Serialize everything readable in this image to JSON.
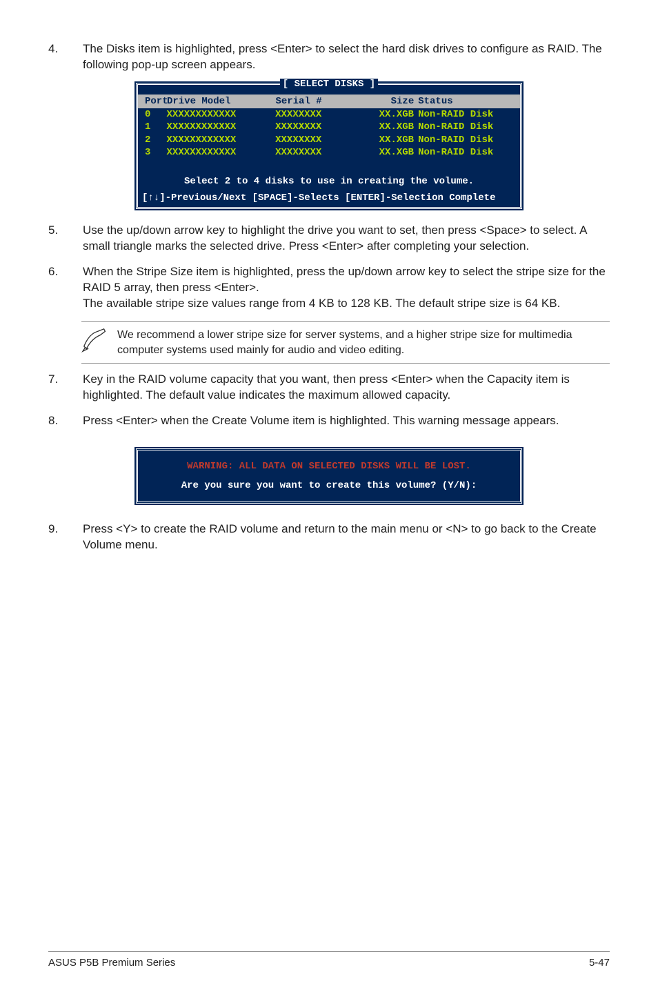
{
  "steps": {
    "s4": {
      "num": "4.",
      "text": "The Disks item is highlighted, press <Enter> to select the hard disk drives to configure as RAID. The following pop-up screen appears."
    },
    "s5": {
      "num": "5.",
      "text": "Use the up/down arrow key to highlight the drive you want to set, then press <Space> to select.  A small triangle marks the selected drive. Press <Enter> after completing your selection."
    },
    "s6": {
      "num": "6.",
      "text": "When the Stripe Size item is highlighted, press the up/down arrow key to select the stripe size for the RAID 5 array, then press <Enter>.\nThe available stripe size values range from 4 KB to 128 KB. The default stripe size is 64 KB."
    },
    "s7": {
      "num": "7.",
      "text": "Key in the RAID volume capacity that you want, then press <Enter> when the Capacity item is highlighted. The default value indicates the maximum allowed capacity."
    },
    "s8": {
      "num": "8.",
      "text": "Press <Enter> when the Create Volume item is highlighted. This warning message appears."
    },
    "s9": {
      "num": "9.",
      "text": "Press <Y> to create the RAID volume and return to the main menu or <N> to go back to the Create Volume menu."
    }
  },
  "note": {
    "text": "We recommend a lower stripe size for server systems, and a higher stripe size for multimedia computer systems used mainly for audio and video editing."
  },
  "console1": {
    "title": "[ SELECT DISKS ]",
    "header": {
      "port": "Port",
      "model": "Drive Model",
      "serial": "Serial #",
      "size": "Size",
      "status": "Status"
    },
    "rows": [
      {
        "port": "0",
        "model": "XXXXXXXXXXXX",
        "serial": "XXXXXXXX",
        "size": "XX.XGB",
        "status": "Non-RAID Disk"
      },
      {
        "port": "1",
        "model": "XXXXXXXXXXXX",
        "serial": "XXXXXXXX",
        "size": "XX.XGB",
        "status": "Non-RAID Disk"
      },
      {
        "port": "2",
        "model": "XXXXXXXXXXXX",
        "serial": "XXXXXXXX",
        "size": "XX.XGB",
        "status": "Non-RAID Disk"
      },
      {
        "port": "3",
        "model": "XXXXXXXXXXXX",
        "serial": "XXXXXXXX",
        "size": "XX.XGB",
        "status": "Non-RAID Disk"
      }
    ],
    "instruct": "Select 2 to 4 disks to use in creating the volume.",
    "footer": "[↑↓]-Previous/Next  [SPACE]-Selects  [ENTER]-Selection Complete"
  },
  "console2": {
    "warn": "WARNING: ALL DATA ON SELECTED DISKS WILL BE LOST.",
    "prompt": "Are you sure you want to create this volume? (Y/N):"
  },
  "footer": {
    "left": "ASUS P5B Premium Series",
    "right": "5-47"
  }
}
